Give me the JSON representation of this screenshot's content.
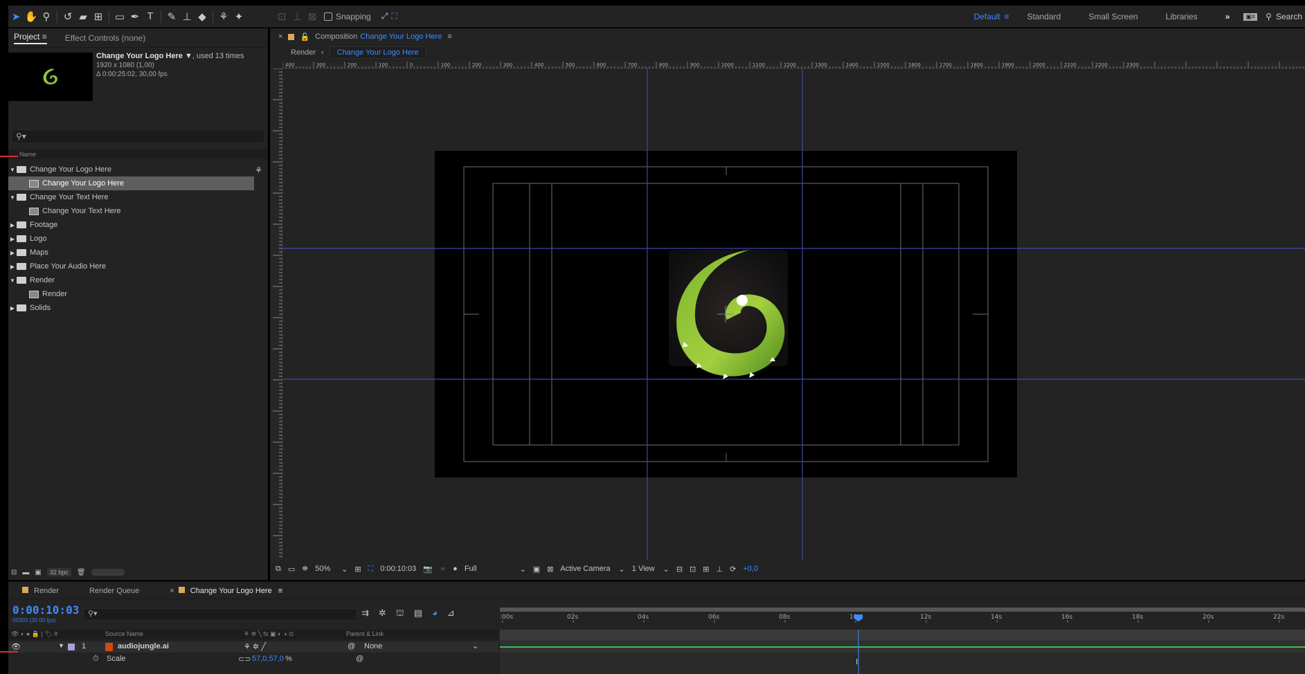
{
  "toolbar": {
    "snapping_label": "Snapping",
    "workspaces": [
      "Default",
      "Standard",
      "Small Screen",
      "Libraries"
    ],
    "active_workspace": "Default",
    "search_label": "Search",
    "tools": [
      "selection-tool",
      "hand-tool",
      "zoom-tool",
      "rotate-tool",
      "camera-tool",
      "pan-behind-tool",
      "rectangle-tool",
      "pen-tool",
      "type-tool",
      "brush-tool",
      "clone-stamp-tool",
      "eraser-tool",
      "roto-brush-tool",
      "puppet-pin-tool"
    ]
  },
  "project": {
    "tabs": [
      "Project",
      "Effect Controls (none)"
    ],
    "selected_item": {
      "name": "Change Your Logo Here",
      "usage": ", used 13 times",
      "resolution": "1920 x 1080 (1,00)",
      "duration": "Δ 0:00:25:02, 30,00 fps"
    },
    "search_placeholder": "",
    "column_name": "Name",
    "bpc": "32 bpc",
    "items": [
      {
        "label": "Change Your Logo Here",
        "type": "folder",
        "expanded": true
      },
      {
        "label": "Change Your Logo Here",
        "type": "comp",
        "selected": true
      },
      {
        "label": "Change Your Text Here",
        "type": "folder",
        "expanded": true
      },
      {
        "label": "Change Your Text Here",
        "type": "comp"
      },
      {
        "label": "Footage",
        "type": "folder",
        "expanded": false
      },
      {
        "label": "Logo",
        "type": "folder",
        "expanded": false
      },
      {
        "label": "Maps",
        "type": "folder",
        "expanded": false
      },
      {
        "label": "Place Your Audio Here",
        "type": "folder",
        "expanded": false
      },
      {
        "label": "Render",
        "type": "folder",
        "expanded": true
      },
      {
        "label": "Render",
        "type": "comp"
      },
      {
        "label": "Solids",
        "type": "folder",
        "expanded": false
      }
    ]
  },
  "composition": {
    "tab_prefix": "Composition",
    "tab_name": "Change Your Logo Here",
    "breadcrumb_parent": "Render",
    "breadcrumb_current": "Change Your Logo Here",
    "ruler_labels": [
      "400",
      "300",
      "200",
      "100",
      "0",
      "100",
      "200",
      "300",
      "400",
      "500",
      "600",
      "700",
      "800",
      "900",
      "1000",
      "1100",
      "1200",
      "1300",
      "1400",
      "1500",
      "1600",
      "1700",
      "1800",
      "1900",
      "2000",
      "2100",
      "2200",
      "2300"
    ],
    "footer": {
      "zoom": "50%",
      "timecode": "0:00:10:03",
      "resolution": "Full",
      "camera": "Active Camera",
      "views": "1 View",
      "exposure": "+0,0"
    },
    "colors": {
      "logo_green": "#8fc23a",
      "logo_dark_green": "#4c8a1c",
      "guide_blue": "#3f48a8"
    }
  },
  "timeline": {
    "tabs": [
      "Render",
      "Render Queue",
      "Change Your Logo Here"
    ],
    "active_tab": "Change Your Logo Here",
    "timecode": "0:00:10:03",
    "timecode_sub": "00303 (30.00 fps)",
    "columns": {
      "source_name": "Source Name",
      "parent_link": "Parent & Link"
    },
    "layer": {
      "index": "1",
      "name": "audiojungle.ai",
      "parent": "None"
    },
    "property": {
      "name": "Scale",
      "value": "57,0,57,0",
      "unit": "%"
    },
    "time_labels": [
      ":00s",
      "02s",
      "04s",
      "06s",
      "08s",
      "10s",
      "12s",
      "14s",
      "16s",
      "18s",
      "20s",
      "22s"
    ]
  }
}
